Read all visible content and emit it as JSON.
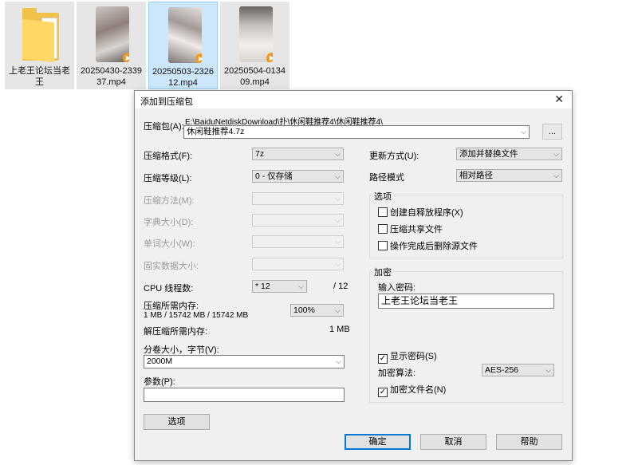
{
  "explorer": {
    "files": [
      {
        "name": "上老王论坛当老王",
        "type": "folder",
        "selected": false
      },
      {
        "name": "20250430-233937.mp4",
        "type": "video",
        "selected": false
      },
      {
        "name": "20250503-232612.mp4",
        "type": "video",
        "selected": true
      },
      {
        "name": "20250504-013409.mp4",
        "type": "video",
        "selected": false
      }
    ],
    "name_lines": [
      [
        "上老王论坛当老",
        "王"
      ],
      [
        "20250430-2339",
        "37.mp4"
      ],
      [
        "20250503-2326",
        "12.mp4"
      ],
      [
        "20250504-0134",
        "09.mp4"
      ]
    ]
  },
  "dialog": {
    "title": "添加到压缩包",
    "close": "✕",
    "archive_label": "压缩包(A):",
    "archive_path": "E:\\BaiduNetdiskDownload\\扑\\休闲鞋推荐4\\休闲鞋推荐4\\",
    "archive_name": "休闲鞋推荐4.7z",
    "browse": "...",
    "format_label": "压缩格式(F):",
    "format_value": "7z",
    "level_label": "压缩等级(L):",
    "level_value": "0 - 仅存储",
    "method_label": "压缩方法(M):",
    "dict_label": "字典大小(D):",
    "word_label": "单词大小(W):",
    "solid_label": "固实数据大小:",
    "threads_label": "CPU 线程数:",
    "threads_value": "* 12",
    "threads_max": "/ 12",
    "mem_label": "压缩所需内存:",
    "mem_detail": "1 MB / 15742 MB / 15742 MB",
    "mem_value": "100%",
    "decomp_label": "解压缩所需内存:",
    "decomp_value": "1 MB",
    "split_label": "分卷大小，字节(V):",
    "split_value": "2000M",
    "params_label": "参数(P):",
    "params_value": "",
    "options_button": "选项",
    "update_label": "更新方式(U):",
    "update_value": "添加并替换文件",
    "path_label": "路径模式",
    "path_value": "相对路径",
    "options_group": "选项",
    "opt_sfx": "创建自释放程序(X)",
    "opt_shared": "压缩共享文件",
    "opt_delete": "操作完成后删除源文件",
    "enc_group": "加密",
    "enc_pw_label": "输入密码:",
    "enc_pw_value": "上老王论坛当老王",
    "enc_show": "显示密码(S)",
    "enc_method_label": "加密算法:",
    "enc_method_value": "AES-256",
    "enc_names": "加密文件名(N)",
    "ok": "确定",
    "cancel": "取消",
    "help": "帮助",
    "check_mark": "✓",
    "dropdown_icon": "⌵",
    "play_icon": "▶"
  }
}
